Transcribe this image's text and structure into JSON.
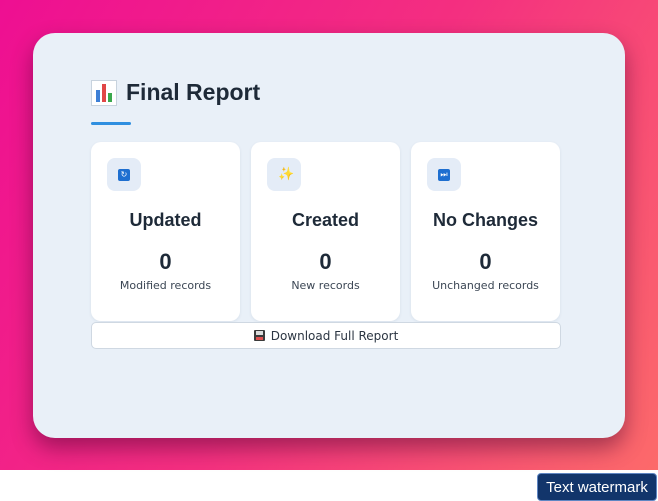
{
  "report": {
    "title": "Final Report",
    "title_icon": "bar-chart-icon"
  },
  "cards": [
    {
      "icon": "refresh-icon",
      "glyph": "↻",
      "title": "Updated",
      "count": "0",
      "subtitle": "Modified records"
    },
    {
      "icon": "sparkles-icon",
      "glyph": "✨",
      "title": "Created",
      "count": "0",
      "subtitle": "New records"
    },
    {
      "icon": "fast-forward-icon",
      "glyph": "⏭",
      "title": "No Changes",
      "count": "0",
      "subtitle": "Unchanged records"
    }
  ],
  "download": {
    "label": "Download Full Report",
    "icon": "floppy-disk-icon"
  },
  "watermark": {
    "text": "Text watermark"
  },
  "colors": {
    "gradient_start": "#ee0f92",
    "gradient_end": "#fc6a6a",
    "panel": "#e9f0f8",
    "accent": "#2f8fe0",
    "watermark_bg": "#12356b"
  }
}
